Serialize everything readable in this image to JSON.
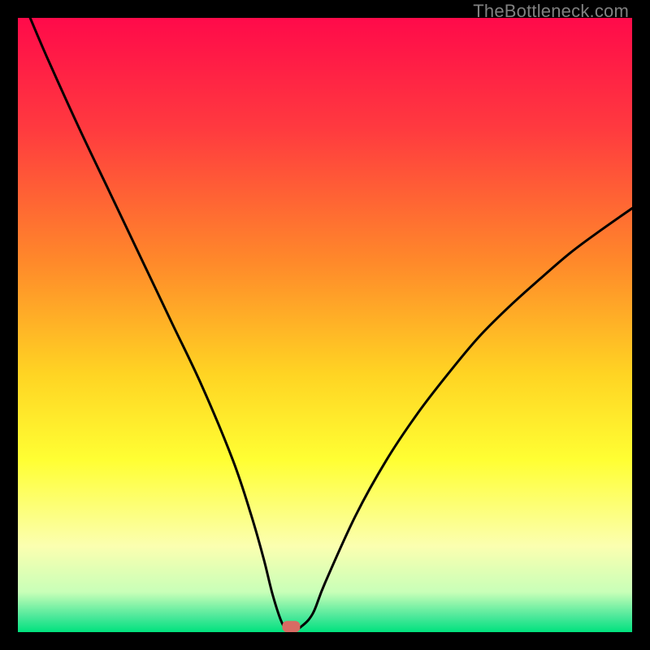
{
  "watermark": "TheBottleneck.com",
  "chart_data": {
    "type": "line",
    "title": "",
    "xlabel": "",
    "ylabel": "",
    "xlim": [
      0,
      100
    ],
    "ylim": [
      0,
      100
    ],
    "curve": {
      "name": "bottleneck-curve",
      "x": [
        2,
        5,
        10,
        15,
        20,
        25,
        30,
        35,
        38,
        40,
        41.5,
        43,
        44,
        45,
        46,
        48,
        50,
        55,
        60,
        65,
        70,
        75,
        80,
        85,
        90,
        95,
        100
      ],
      "y": [
        100,
        93,
        82,
        71.5,
        61,
        50.5,
        40,
        28,
        19,
        12,
        6,
        1.5,
        0.5,
        0.5,
        0.8,
        3,
        8,
        19,
        28,
        35.5,
        42,
        48,
        53,
        57.5,
        61.8,
        65.5,
        69
      ]
    },
    "marker": {
      "x": 44.5,
      "y": 0.9,
      "color": "#d86b63"
    },
    "background_gradient": {
      "stops": [
        {
          "offset": 0.0,
          "color": "#ff0a4a"
        },
        {
          "offset": 0.18,
          "color": "#ff3a3f"
        },
        {
          "offset": 0.4,
          "color": "#ff8a2a"
        },
        {
          "offset": 0.58,
          "color": "#ffd423"
        },
        {
          "offset": 0.72,
          "color": "#ffff33"
        },
        {
          "offset": 0.86,
          "color": "#fbffb0"
        },
        {
          "offset": 0.935,
          "color": "#c8ffb8"
        },
        {
          "offset": 0.975,
          "color": "#4be89a"
        },
        {
          "offset": 1.0,
          "color": "#00e27e"
        }
      ]
    }
  }
}
